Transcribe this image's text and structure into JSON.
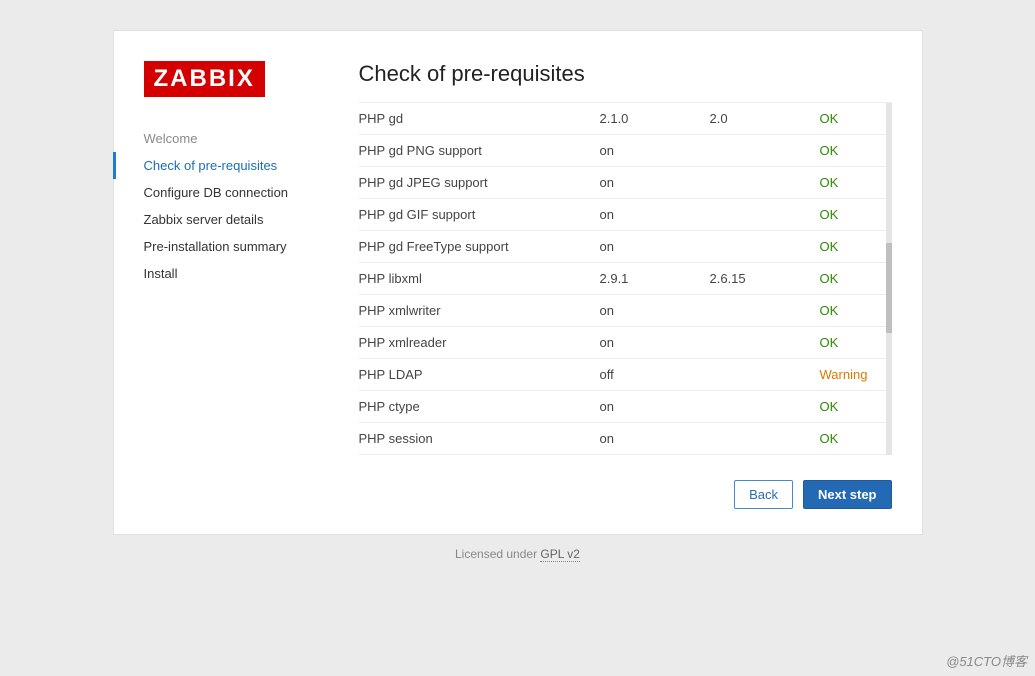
{
  "brand": {
    "logo_text": "ZABBIX"
  },
  "sidebar": {
    "items": [
      {
        "label": "Welcome",
        "state": "completed"
      },
      {
        "label": "Check of pre-requisites",
        "state": "active"
      },
      {
        "label": "Configure DB connection",
        "state": ""
      },
      {
        "label": "Zabbix server details",
        "state": ""
      },
      {
        "label": "Pre-installation summary",
        "state": ""
      },
      {
        "label": "Install",
        "state": ""
      }
    ]
  },
  "main": {
    "title": "Check of pre-requisites",
    "rows": [
      {
        "name": "PHP gd",
        "current": "2.1.0",
        "required": "2.0",
        "status": "OK",
        "status_class": "ok"
      },
      {
        "name": "PHP gd PNG support",
        "current": "on",
        "required": "",
        "status": "OK",
        "status_class": "ok"
      },
      {
        "name": "PHP gd JPEG support",
        "current": "on",
        "required": "",
        "status": "OK",
        "status_class": "ok"
      },
      {
        "name": "PHP gd GIF support",
        "current": "on",
        "required": "",
        "status": "OK",
        "status_class": "ok"
      },
      {
        "name": "PHP gd FreeType support",
        "current": "on",
        "required": "",
        "status": "OK",
        "status_class": "ok"
      },
      {
        "name": "PHP libxml",
        "current": "2.9.1",
        "required": "2.6.15",
        "status": "OK",
        "status_class": "ok"
      },
      {
        "name": "PHP xmlwriter",
        "current": "on",
        "required": "",
        "status": "OK",
        "status_class": "ok"
      },
      {
        "name": "PHP xmlreader",
        "current": "on",
        "required": "",
        "status": "OK",
        "status_class": "ok"
      },
      {
        "name": "PHP LDAP",
        "current": "off",
        "required": "",
        "status": "Warning",
        "status_class": "warn"
      },
      {
        "name": "PHP ctype",
        "current": "on",
        "required": "",
        "status": "OK",
        "status_class": "ok"
      },
      {
        "name": "PHP session",
        "current": "on",
        "required": "",
        "status": "OK",
        "status_class": "ok"
      }
    ]
  },
  "buttons": {
    "back": "Back",
    "next": "Next step"
  },
  "license": {
    "prefix": "Licensed under ",
    "link": "GPL v2"
  },
  "watermark": "@51CTO博客"
}
